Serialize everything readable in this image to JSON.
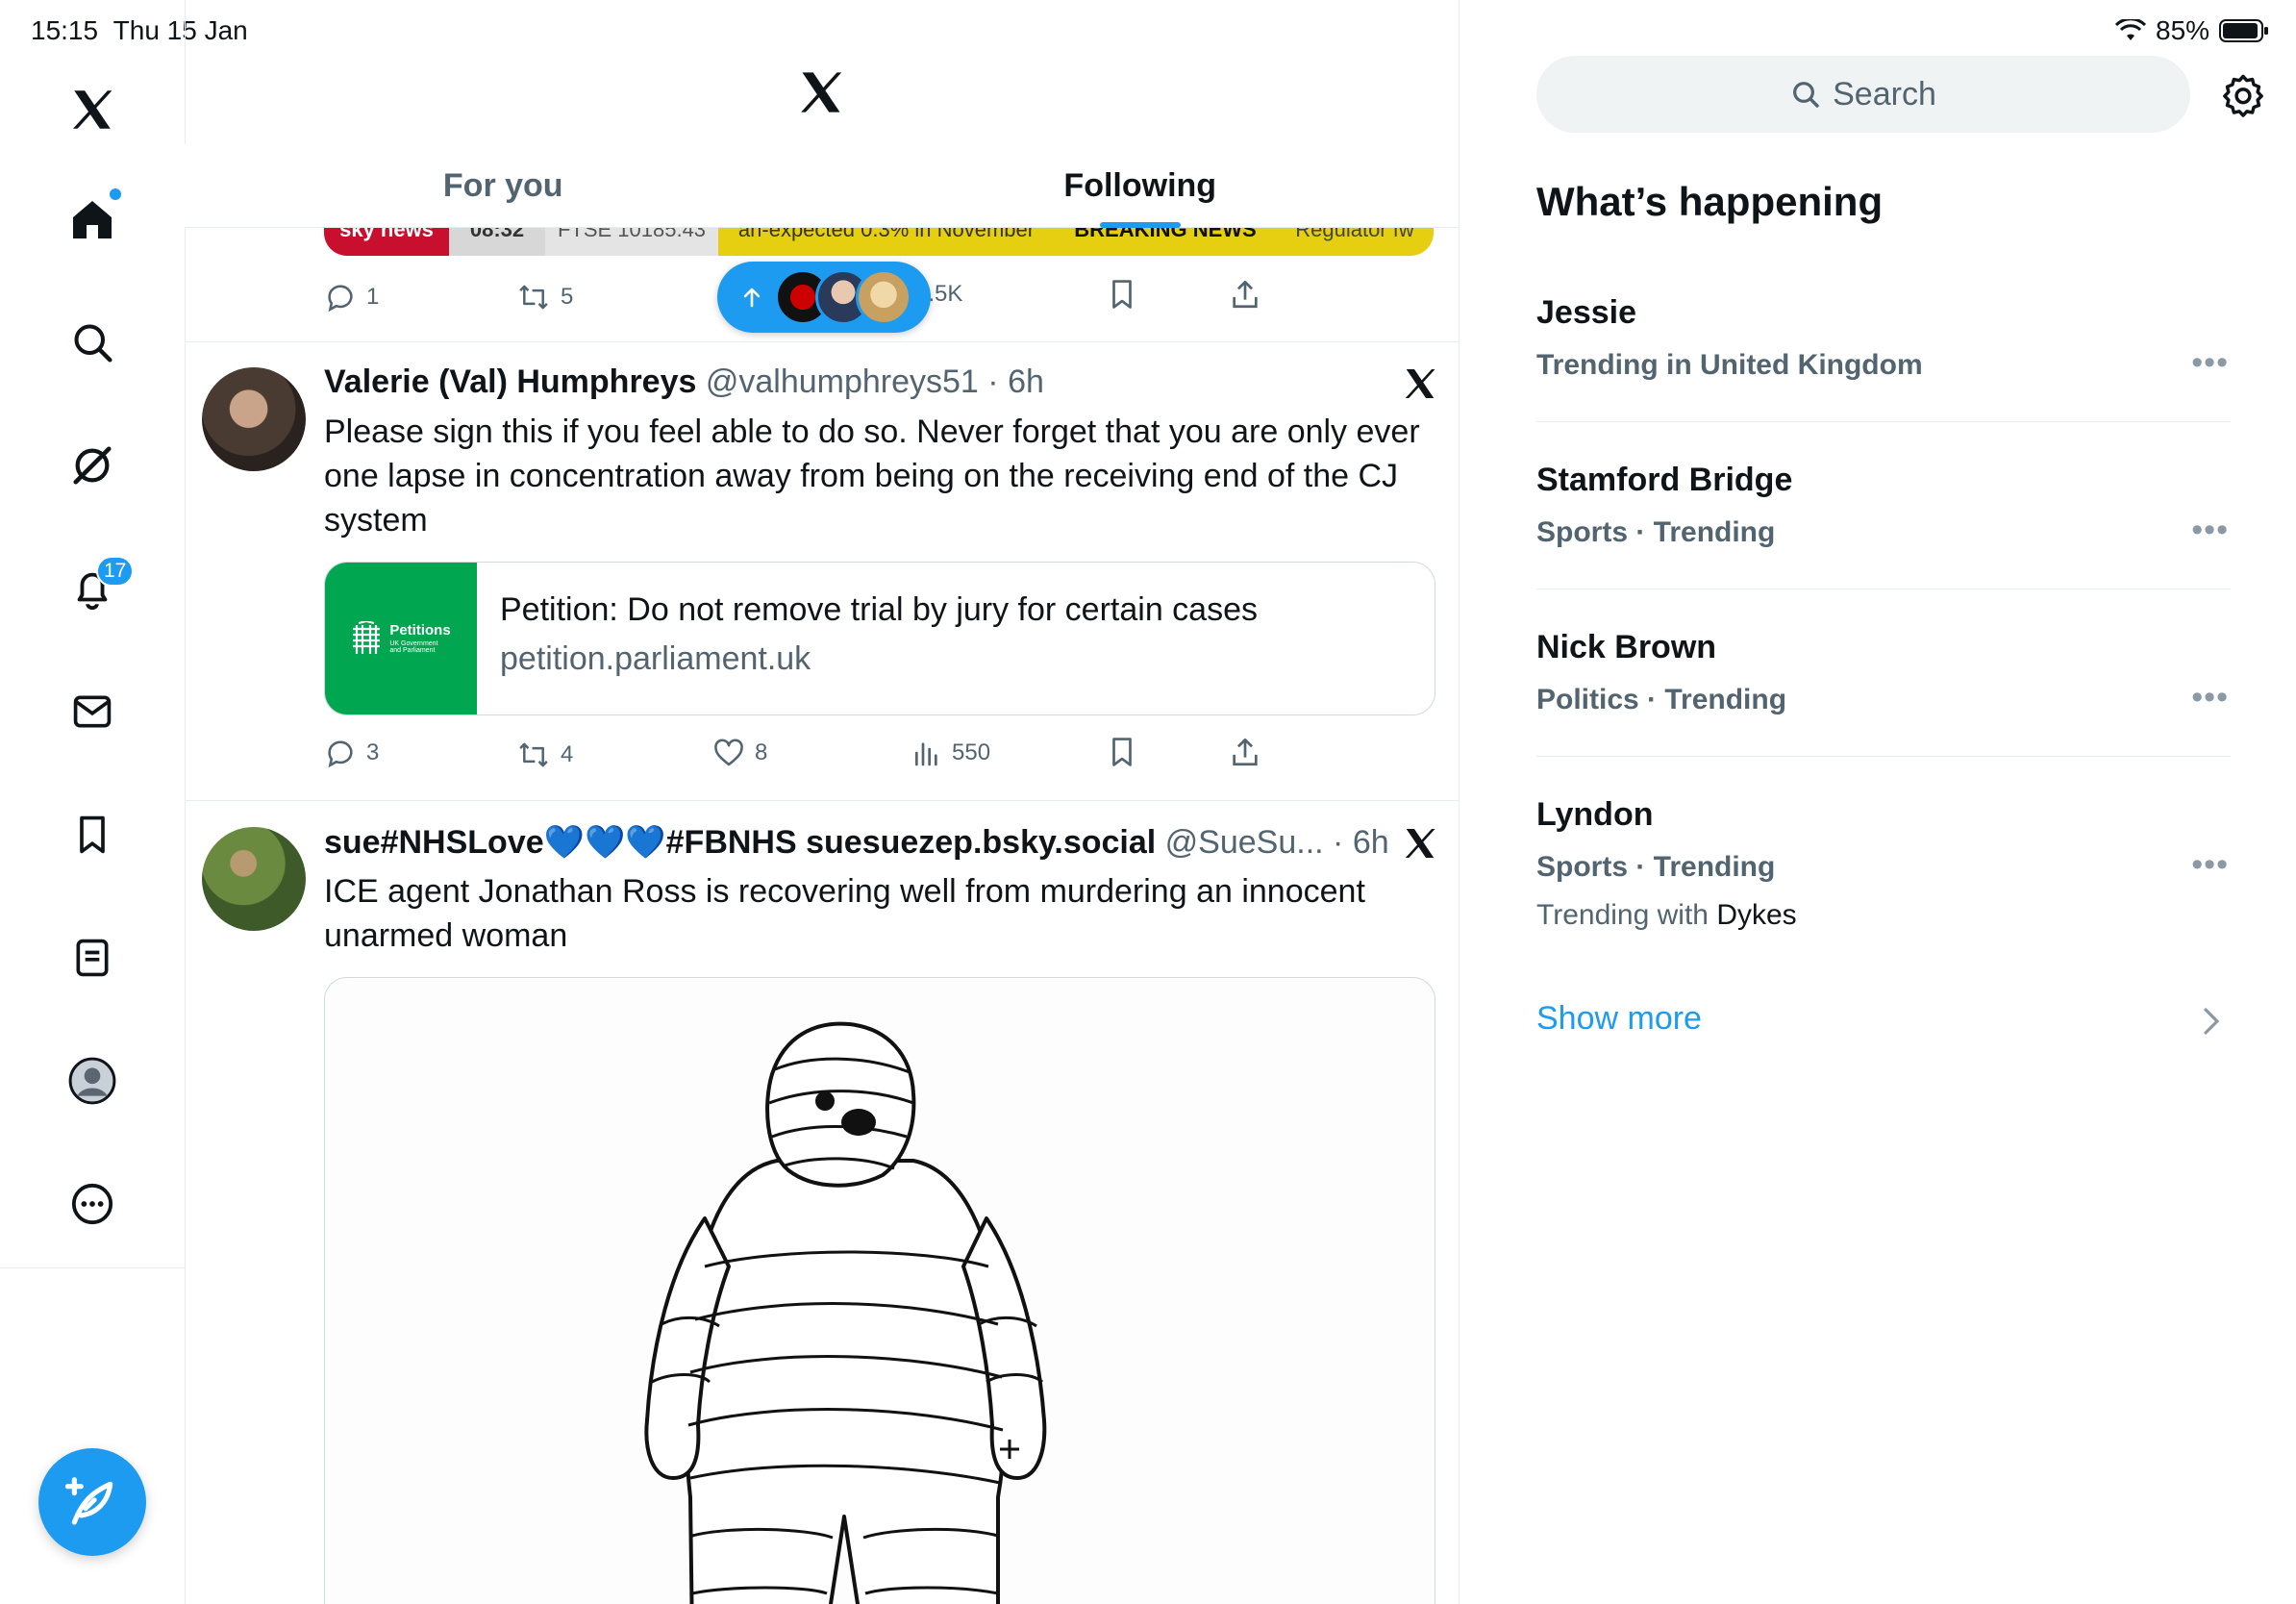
{
  "status_bar": {
    "time": "15:15",
    "date": "Thu 15 Jan",
    "battery": "85%"
  },
  "colors": {
    "accent": "#1d9bf0",
    "text": "#0f1419",
    "muted": "#536471"
  },
  "left_nav": {
    "notification_badge": "17",
    "icons": [
      "x-logo-icon",
      "home-icon",
      "search-icon",
      "grok-icon",
      "bell-icon",
      "mail-icon",
      "bookmark-icon",
      "lists-icon",
      "profile-icon",
      "more-icon"
    ]
  },
  "header": {
    "tabs": [
      {
        "label": "For you"
      },
      {
        "label": "Following"
      }
    ],
    "active_tab": "Following"
  },
  "previous_post": {
    "banner_texts": [
      "sky news",
      "08:32",
      "FTSE 10185.43",
      "an-expected 0.3% in November",
      "BREAKING NEWS",
      "Regulator fw"
    ],
    "replies": "1",
    "reposts": "5",
    "views": "1.5K"
  },
  "new_posts_pill": {
    "icon": "arrow-up-icon"
  },
  "posts": [
    {
      "name": "Valerie (Val) Humphreys",
      "handle": "@valhumphreys51",
      "time": "6h",
      "text": "Please sign this if you feel able to do so. Never forget that you are only ever one lapse in concentration away from being on the receiving end of the CJ system",
      "card": {
        "logo_title": "Petitions",
        "logo_sub1": "UK Government",
        "logo_sub2": "and Parliament",
        "title": "Petition: Do not remove trial by jury for certain cases",
        "domain": "petition.parliament.uk"
      },
      "replies": "3",
      "reposts": "4",
      "likes": "8",
      "views": "550"
    },
    {
      "name": "sue#NHSLove💙💙💙#FBNHS suesuezep.bsky.social",
      "handle": "@SueSu...",
      "time": "6h",
      "text": "ICE agent Jonathan Ross is recovering well from murdering an innocent unarmed woman"
    }
  ],
  "sidebar": {
    "search_placeholder": "Search",
    "heading": "What’s happening",
    "trends": [
      {
        "title": "Jessie",
        "context": "Trending in United Kingdom"
      },
      {
        "title": "Stamford Bridge",
        "context": "Sports · Trending"
      },
      {
        "title": "Nick Brown",
        "context": "Politics · Trending"
      },
      {
        "title": "Lyndon",
        "context": "Sports · Trending",
        "with_prefix": "Trending with",
        "with_name": "Dykes"
      }
    ],
    "show_more": "Show more"
  }
}
